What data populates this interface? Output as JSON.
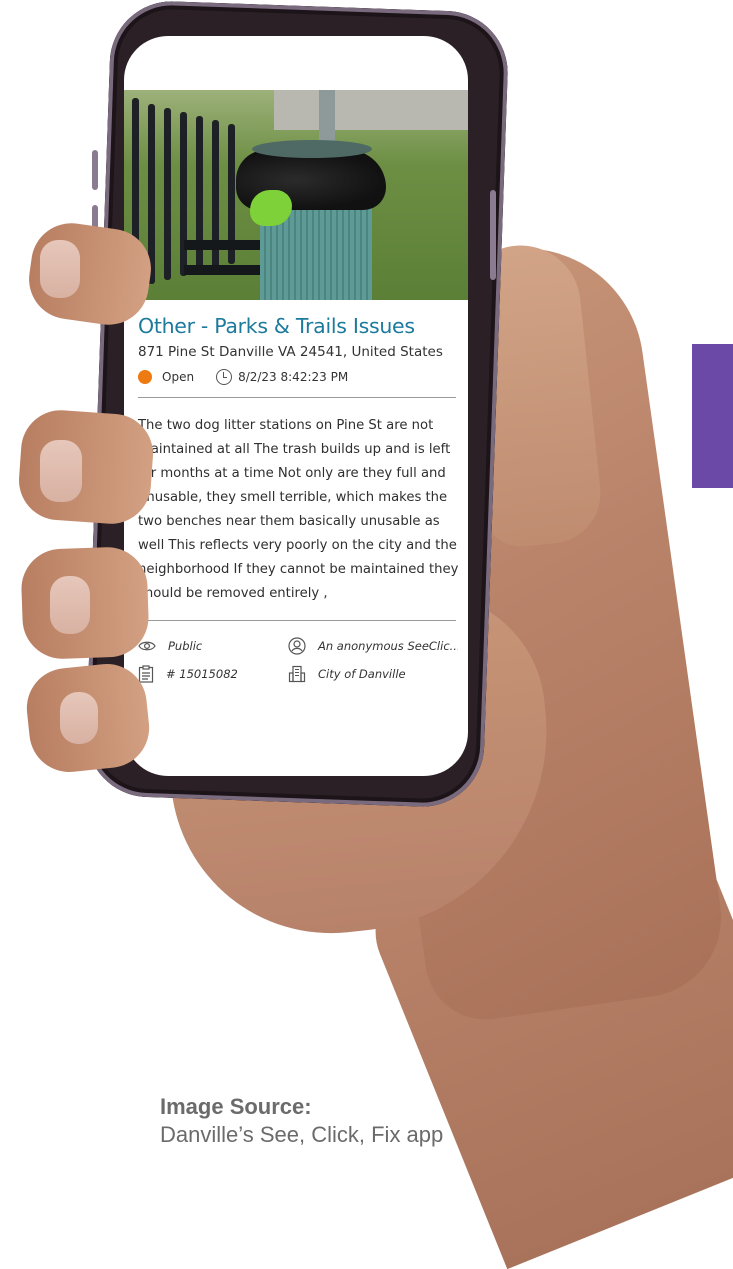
{
  "report": {
    "title": "Other - Parks & Trails Issues",
    "address": "871 Pine St Danville VA 24541, United States",
    "status": "Open",
    "status_color": "#ee7a12",
    "timestamp": "8/2/23 8:42:23 PM",
    "description": "The two dog litter stations on Pine St are not maintained at all The trash builds up and is left for months at a time Not only are they full and unusable, they smell terrible, which makes the two benches near them basically unusable as well This reflects very poorly on the city and the neighborhood If they cannot be maintained they should be removed entirely ,",
    "visibility": "Public",
    "reporter": "An anonymous SeeClic...",
    "issue_number": "# 15015082",
    "organization": "City of Danville"
  },
  "caption": {
    "title": "Image Source:",
    "subtitle": "Danville’s See, Click, Fix app"
  },
  "colors": {
    "title_blue": "#1c7a9c",
    "accent_purple": "#6a4aa6"
  }
}
